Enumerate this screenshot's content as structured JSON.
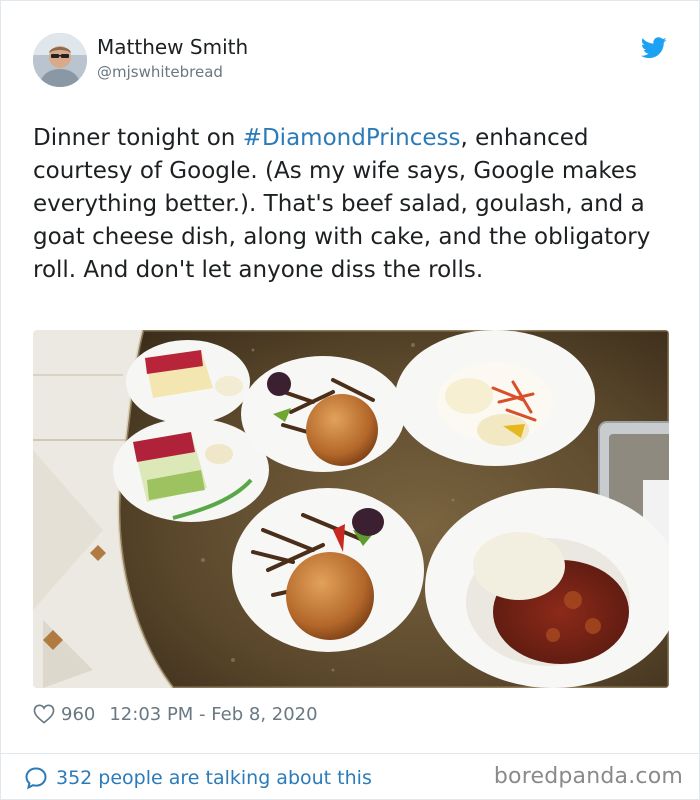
{
  "author": {
    "display_name": "Matthew Smith",
    "handle": "@mjswhitebread"
  },
  "icons": {
    "brand": "twitter-bird-icon",
    "like": "heart-icon",
    "reply": "speech-bubble-icon"
  },
  "tweet": {
    "text_before": "Dinner tonight on ",
    "hashtag": "#DiamondPrincess",
    "text_after": ", enhanced courtesy of Google.  (As my wife says, Google makes everything better.). That's beef salad, goulash, and a goat cheese dish, along with cake, and the obligatory roll.  And don't let anyone diss the rolls."
  },
  "meta": {
    "likes": "960",
    "timestamp": "12:03 PM - Feb 8, 2020"
  },
  "footer": {
    "talking": "352 people are talking about this",
    "watermark": "boredpanda.com"
  },
  "colors": {
    "link": "#2b7bb9",
    "secondary_text": "#697882",
    "twitter_blue": "#1da1f2"
  }
}
